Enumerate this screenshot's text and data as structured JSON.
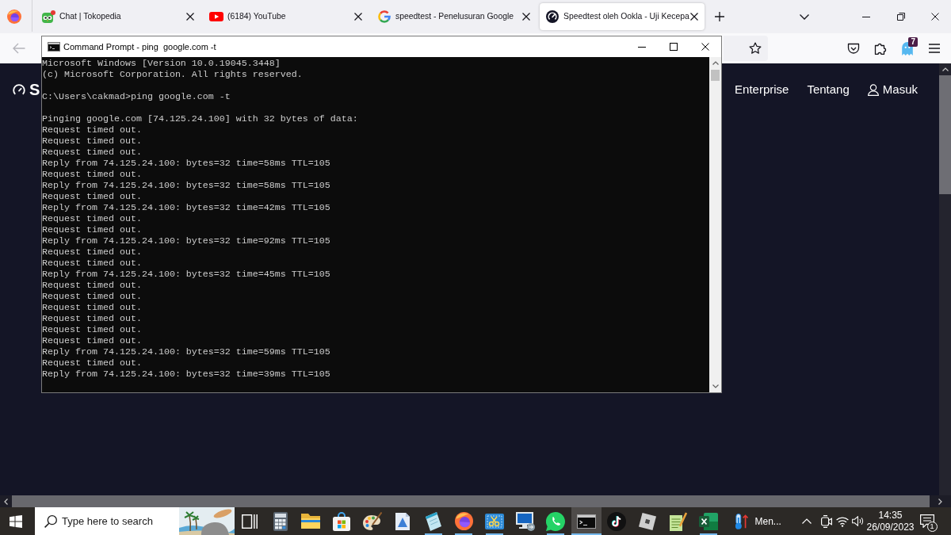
{
  "browser": {
    "tabs": [
      {
        "kind": "tokopedia",
        "title": "Chat | Tokopedia",
        "selected": false
      },
      {
        "kind": "youtube",
        "title": "(6184) YouTube",
        "selected": false
      },
      {
        "kind": "google",
        "title": "speedtest - Penelusuran Google",
        "selected": false
      },
      {
        "kind": "speedtest",
        "title": "Speedtest oleh Ookla - Uji Kecepa",
        "selected": true
      }
    ],
    "toolbar": {
      "back_disabled": true,
      "extension_badge": "7"
    }
  },
  "page": {
    "logo_text": "S",
    "nav": [
      {
        "kind": "link",
        "label": "Enterprise"
      },
      {
        "kind": "link",
        "label": "Tentang"
      },
      {
        "kind": "account",
        "label": "Masuk"
      }
    ]
  },
  "console_window": {
    "title": "Command Prompt - ping  google.com -t",
    "blocks": [
      [
        "Microsoft Windows [Version 10.0.19045.3448]",
        "(c) Microsoft Corporation. All rights reserved."
      ],
      [
        "C:\\Users\\cakmad>ping google.com -t"
      ],
      [
        "Pinging google.com [74.125.24.100] with 32 bytes of data:",
        "Request timed out.",
        "Request timed out.",
        "Request timed out.",
        "Reply from 74.125.24.100: bytes=32 time=58ms TTL=105",
        "Request timed out.",
        "Reply from 74.125.24.100: bytes=32 time=58ms TTL=105",
        "Request timed out.",
        "Reply from 74.125.24.100: bytes=32 time=42ms TTL=105",
        "Request timed out.",
        "Request timed out.",
        "Reply from 74.125.24.100: bytes=32 time=92ms TTL=105",
        "Request timed out.",
        "Request timed out.",
        "Reply from 74.125.24.100: bytes=32 time=45ms TTL=105",
        "Request timed out.",
        "Request timed out.",
        "Request timed out.",
        "Request timed out.",
        "Request timed out.",
        "Request timed out.",
        "Reply from 74.125.24.100: bytes=32 time=59ms TTL=105",
        "Request timed out.",
        "Reply from 74.125.24.100: bytes=32 time=39ms TTL=105"
      ]
    ]
  },
  "taskbar": {
    "search": {
      "placeholder": "Type here to search"
    },
    "apps": [
      {
        "kind": "task_view",
        "running": false,
        "active": false
      },
      {
        "kind": "calculator",
        "running": false,
        "active": false
      },
      {
        "kind": "file_explorer",
        "running": false,
        "active": false
      },
      {
        "kind": "store",
        "running": false,
        "active": false
      },
      {
        "kind": "paint",
        "running": false,
        "active": false
      },
      {
        "kind": "document",
        "running": false,
        "active": false
      },
      {
        "kind": "notes",
        "running": true,
        "active": false
      },
      {
        "kind": "firefox",
        "running": true,
        "active": false
      },
      {
        "kind": "snipping",
        "running": true,
        "active": false
      },
      {
        "kind": "remote_desktop",
        "running": false,
        "active": false
      },
      {
        "kind": "whatsapp",
        "running": true,
        "active": false
      },
      {
        "kind": "terminal",
        "running": true,
        "active": true
      },
      {
        "kind": "tiktok",
        "running": false,
        "active": false
      },
      {
        "kind": "roblox",
        "running": false,
        "active": false
      },
      {
        "kind": "notepad_pp",
        "running": false,
        "active": false
      },
      {
        "kind": "excel",
        "running": true,
        "active": false
      }
    ],
    "weather": {
      "label": "Men..."
    },
    "clock": {
      "time": "14:35",
      "date": "26/09/2023"
    },
    "notifications": {
      "count": "1"
    }
  }
}
